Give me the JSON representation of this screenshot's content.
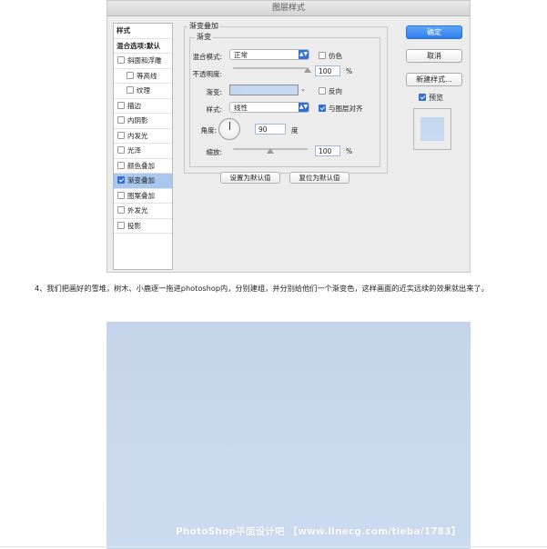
{
  "dialog": {
    "title": "图层样式",
    "sidebar": {
      "items": [
        {
          "label": "样式",
          "type": "head"
        },
        {
          "label": "混合选项:默认",
          "type": "head"
        },
        {
          "label": "斜面和浮雕",
          "type": "check",
          "checked": false
        },
        {
          "label": "等高线",
          "type": "check-indent",
          "checked": false
        },
        {
          "label": "纹理",
          "type": "check-indent",
          "checked": false
        },
        {
          "label": "描边",
          "type": "check",
          "checked": false
        },
        {
          "label": "内阴影",
          "type": "check",
          "checked": false
        },
        {
          "label": "内发光",
          "type": "check",
          "checked": false
        },
        {
          "label": "光泽",
          "type": "check",
          "checked": false
        },
        {
          "label": "颜色叠加",
          "type": "check",
          "checked": false
        },
        {
          "label": "渐变叠加",
          "type": "check",
          "checked": true,
          "selected": true
        },
        {
          "label": "图案叠加",
          "type": "check",
          "checked": false
        },
        {
          "label": "外发光",
          "type": "check",
          "checked": false
        },
        {
          "label": "投影",
          "type": "check",
          "checked": false
        }
      ]
    },
    "panel": {
      "group_title": "渐变叠加",
      "sub_title": "渐变",
      "blend_mode_label": "混合模式:",
      "blend_mode_value": "正常",
      "dither_label": "仿色",
      "opacity_label": "不透明度:",
      "opacity_value": "100",
      "opacity_unit": "%",
      "opacity_level": 1.0,
      "gradient_label": "渐变:",
      "reverse_label": "反向",
      "style_label": "样式:",
      "style_value": "线性",
      "align_label": "与图层对齐",
      "angle_label": "角度:",
      "angle_value": "90",
      "angle_unit": "度",
      "scale_label": "缩放:",
      "scale_value": "100",
      "scale_unit": "%",
      "scale_level": 0.5,
      "set_default_label": "设置为默认值",
      "reset_default_label": "复位为默认值"
    },
    "buttons": {
      "ok": "确定",
      "cancel": "取消",
      "new_style": "新建样式...",
      "preview_label": "预览"
    }
  },
  "paragraph": "4、我们把画好的雪堆，树木、小鹿逐一拖进photoshop内，分别建组，并分别给他们一个渐变色，这样画面的近实远续的效果就出来了。",
  "watermark": "PhotoShop平面设计吧 【www.linecg.com/tieba/1783】",
  "colors": {
    "accent": "#2f6fd6",
    "selection": "#a7c7ef",
    "gradient_swatch": "#c6d8f0",
    "image_bg": "#c8d9f0"
  }
}
